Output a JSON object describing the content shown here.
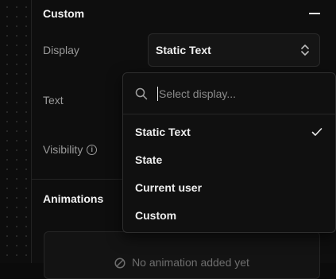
{
  "custom_section": {
    "title": "Custom",
    "display_label": "Display",
    "text_label": "Text",
    "visibility_label": "Visibility",
    "info_glyph": "i",
    "display_select": {
      "value": "Static Text",
      "icon": "chevron-up-down-icon"
    }
  },
  "animations_section": {
    "title": "Animations",
    "empty_text": "No animation added yet"
  },
  "dropdown": {
    "search_placeholder": "Select display...",
    "search_value": "",
    "options": [
      {
        "label": "Static Text",
        "selected": true
      },
      {
        "label": "State",
        "selected": false
      },
      {
        "label": "Current user",
        "selected": false
      },
      {
        "label": "Custom",
        "selected": false
      }
    ],
    "check_glyph": "✓"
  },
  "colors": {
    "background": "#0e0e0e",
    "text": "#f2f2f2",
    "muted": "#9a9a9a",
    "border": "#2a2a2a"
  }
}
